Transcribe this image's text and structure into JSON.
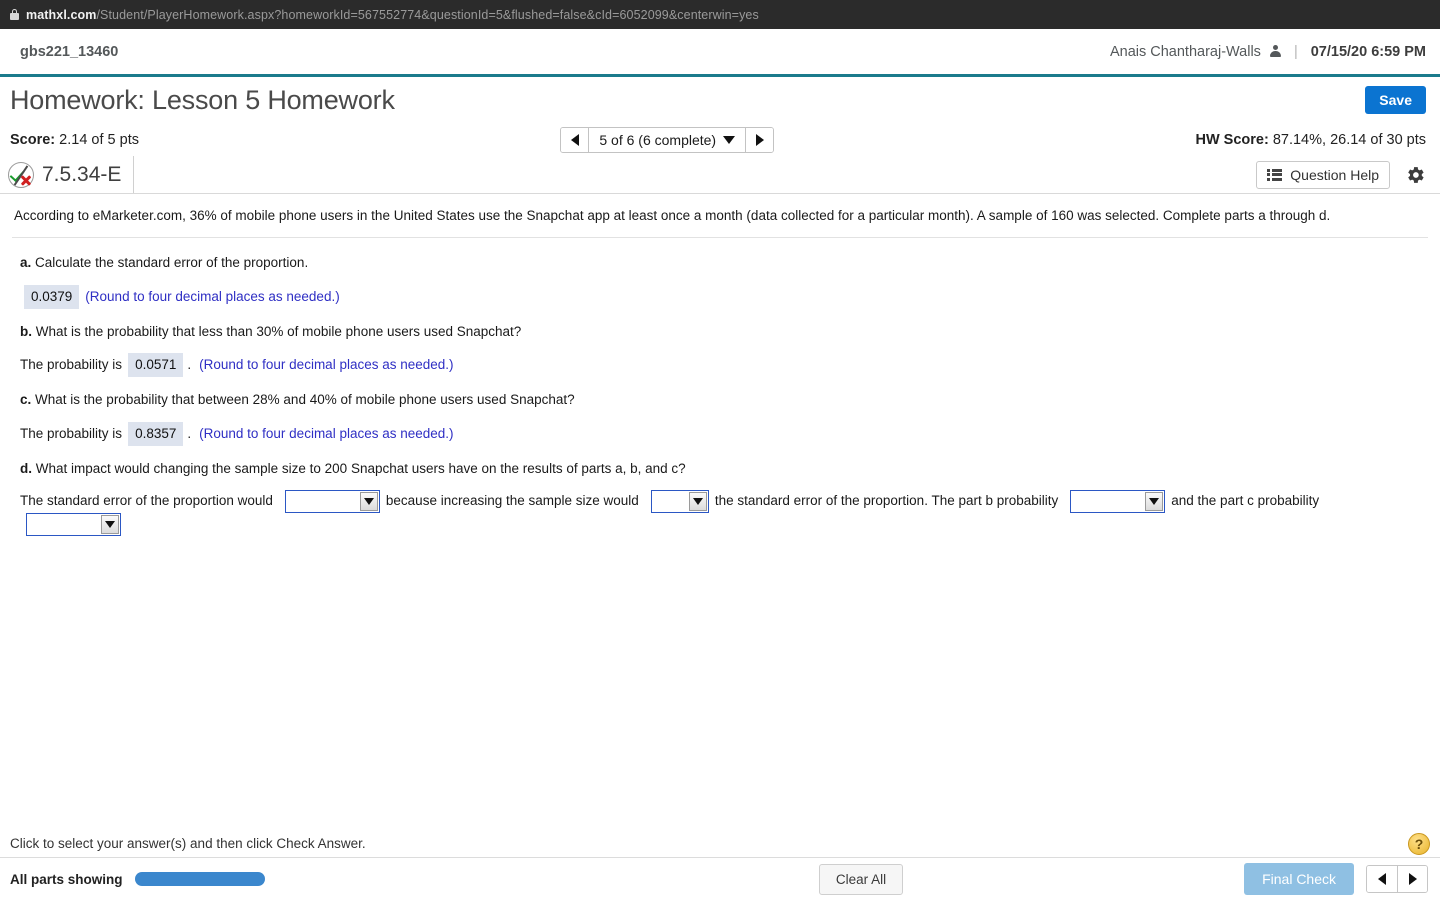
{
  "browser": {
    "lock_icon": "lock-icon",
    "url_domain": "mathxl.com",
    "url_path": "/Student/PlayerHomework.aspx?homeworkId=567552774&questionId=5&flushed=false&cId=6052099&centerwin=yes"
  },
  "header": {
    "course_id": "gbs221_13460",
    "user_name": "Anais Chantharaj-Walls",
    "person_icon": "person-icon",
    "separator": "|",
    "timestamp": "07/15/20 6:59 PM"
  },
  "title_row": {
    "title": "Homework: Lesson 5 Homework",
    "save_label": "Save"
  },
  "score_bar": {
    "score_label": "Score:",
    "score_value": "2.14 of 5 pts",
    "nav_prev_icon": "triangle-left-icon",
    "nav_next_icon": "triangle-right-icon",
    "question_selector": "5 of 6 (6 complete)",
    "hw_score_label": "HW Score:",
    "hw_score_value": "87.14%, 26.14 of 30 pts"
  },
  "question_header": {
    "status_icon": "partial-credit-icon",
    "question_id": "7.5.34-E",
    "question_help_label": "Question Help",
    "list_icon": "list-icon",
    "gear_icon": "gear-icon"
  },
  "question": {
    "stem": "According to eMarketer.com, 36% of mobile phone users in the United States use the Snapchat app at least once a month (data collected for a particular month). A sample of 160 was selected. Complete parts a through d.",
    "parts": [
      {
        "label": "a.",
        "text": "Calculate the standard error of the proportion.",
        "answer": "0.0379",
        "hint": "(Round to four decimal places as needed.)"
      },
      {
        "label": "b.",
        "text": "What is the probability that less than 30% of mobile phone users used Snapchat?",
        "prefix": "The probability is",
        "answer": "0.0571",
        "period": ".",
        "hint": "(Round to four decimal places as needed.)"
      },
      {
        "label": "c.",
        "text": "What is the probability that between 28% and 40% of mobile phone users used Snapchat?",
        "prefix": "The probability is",
        "answer": "0.8357",
        "period": ".",
        "hint": "(Round to four decimal places as needed.)"
      },
      {
        "label": "d.",
        "text": "What impact would changing the sample size to 200 Snapchat users have on the results of parts a, b, and c?"
      }
    ],
    "part_d_sentence": {
      "seg1": "The standard error of the proportion would",
      "dd1_value": "",
      "seg2": "because increasing the sample size would",
      "dd2_value": "",
      "seg3": "the standard error of the proportion. The part b probability",
      "dd3_value": "",
      "seg4": "and the part c probability",
      "dd4_value": ""
    }
  },
  "footer": {
    "instruction": "Click to select your answer(s) and then click Check Answer.",
    "help_icon_label": "?",
    "parts_showing": "All parts showing",
    "clear_all_label": "Clear All",
    "final_check_label": "Final Check",
    "prev_icon": "triangle-left-icon",
    "next_icon": "triangle-right-icon"
  }
}
